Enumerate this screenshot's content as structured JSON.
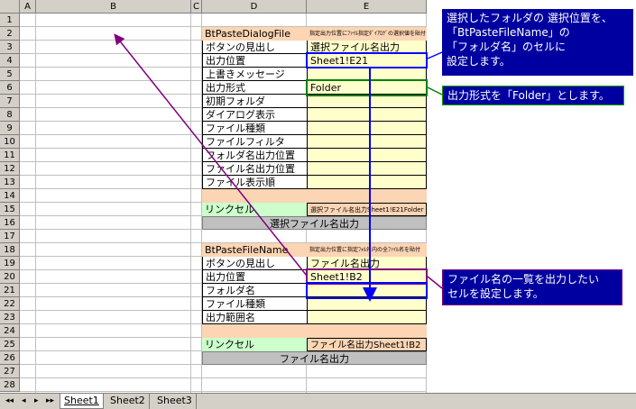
{
  "columns": [
    "A",
    "B",
    "C",
    "D",
    "E"
  ],
  "rows": [
    "1",
    "2",
    "3",
    "4",
    "5",
    "6",
    "7",
    "8",
    "9",
    "10",
    "11",
    "12",
    "13",
    "14",
    "15",
    "16",
    "17",
    "18",
    "19",
    "20",
    "21",
    "22",
    "23",
    "24",
    "25",
    "26",
    "27",
    "28"
  ],
  "section1": {
    "title": "BtPasteDialogFile",
    "note": "指定出力位置にﾌｧｲﾙ指定ﾀﾞｲｱﾛｸﾞの選択値を貼付",
    "labels": [
      "ボタンの見出し",
      "出力位置",
      "上書きメッセージ",
      "出力形式",
      "初期フォルダ",
      "ダイアログ表示",
      "ファイル種類",
      "ファイルフィルタ",
      "フォルダ名出力位置",
      "ファイル名出力位置",
      "ファイル表示順"
    ],
    "values": [
      "選択ファイル名出力",
      "Sheet1!E21",
      "",
      "Folder",
      "",
      "",
      "",
      "",
      "",
      "",
      ""
    ],
    "link_label": "リンクセル",
    "link_value": "選択ファイル名出力Sheet1!E21Folder",
    "button_label": "選択ファイル名出力"
  },
  "section2": {
    "title": "BtPasteFileName",
    "note": "指定出力位置に指定ﾌｫﾙﾀﾞ内の全ﾌｧｲﾙ名を貼付",
    "labels": [
      "ボタンの見出し",
      "出力位置",
      "フォルダ名",
      "ファイル種類",
      "出力範囲名"
    ],
    "values": [
      "ファイル名出力",
      "Sheet1!B2",
      "",
      "",
      ""
    ],
    "link_label": "リンクセル",
    "link_value": "ファイル名出力Sheet1!B2",
    "button_label": "ファイル名出力"
  },
  "callouts": {
    "top": [
      "選択したフォルダの 選択位置を、",
      "「BtPasteFileName」の",
      "「フォルダ名」のセルに",
      "設定します。"
    ],
    "format": "出力形式を「Folder」とします。",
    "bottom": [
      "ファイル名の一覧を出力したい",
      "セルを設定します。"
    ]
  },
  "sheet_tabs": [
    "Sheet1",
    "Sheet2",
    "Sheet3"
  ],
  "nav_glyphs": [
    "◂◂",
    "◂",
    "▸",
    "▸▸"
  ],
  "colors": {
    "title_bg": "#fcd5b4",
    "value_bg": "#ffffcc",
    "link_label_bg": "#ccffcc",
    "button_bg": "#c0c0c0",
    "callout_bg": "#0000a0",
    "arrow": "#800080",
    "blue_box": "#0000ff",
    "green_box": "#008000"
  }
}
